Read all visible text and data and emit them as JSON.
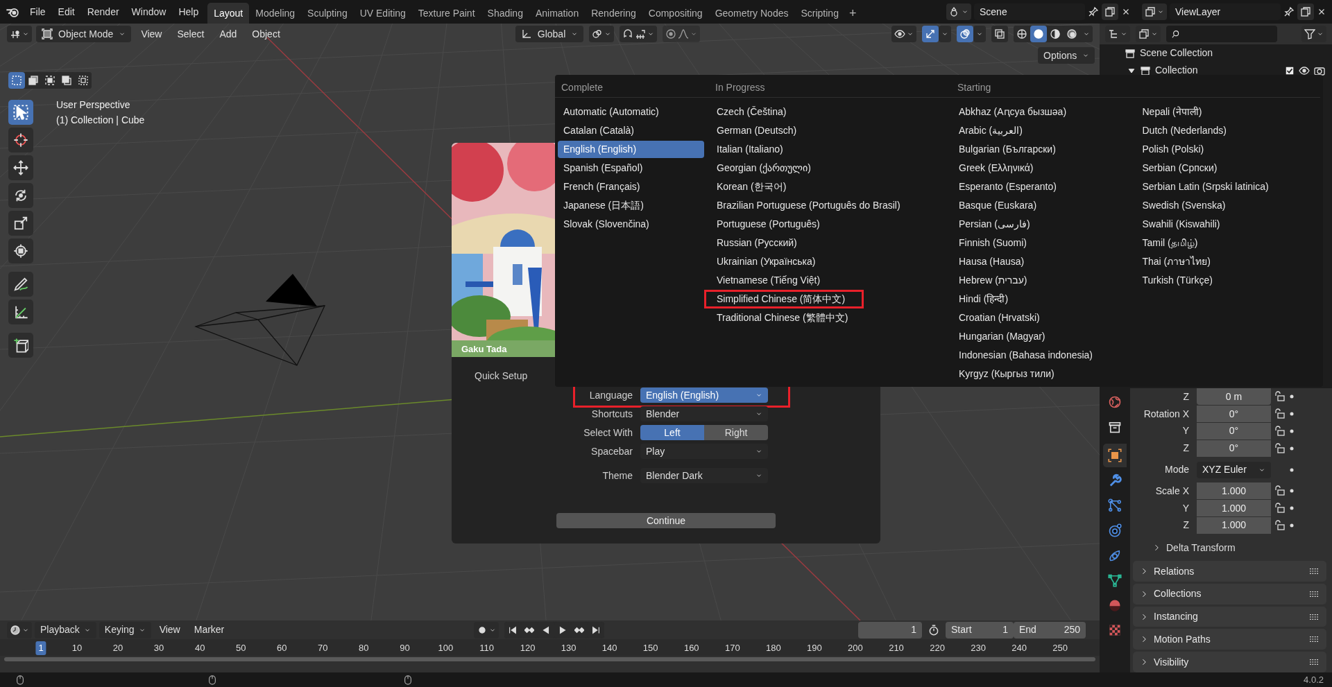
{
  "top_bar": {
    "menus": [
      "File",
      "Edit",
      "Render",
      "Window",
      "Help"
    ],
    "workspaces": [
      {
        "label": "Layout",
        "selected": true
      },
      {
        "label": "Modeling",
        "selected": false
      },
      {
        "label": "Sculpting",
        "selected": false
      },
      {
        "label": "UV Editing",
        "selected": false
      },
      {
        "label": "Texture Paint",
        "selected": false
      },
      {
        "label": "Shading",
        "selected": false
      },
      {
        "label": "Animation",
        "selected": false
      },
      {
        "label": "Rendering",
        "selected": false
      },
      {
        "label": "Compositing",
        "selected": false
      },
      {
        "label": "Geometry Nodes",
        "selected": false
      },
      {
        "label": "Scripting",
        "selected": false
      }
    ],
    "add_tab": "+",
    "scene": "Scene",
    "view_layer": "ViewLayer"
  },
  "viewport": {
    "mode": "Object Mode",
    "menus": [
      "View",
      "Select",
      "Add",
      "Object"
    ],
    "orientation": "Global",
    "options": "Options",
    "view_name": "User Perspective",
    "object_info": "(1) Collection | Cube",
    "shading": [
      {
        "kind": "wireframe",
        "selected": false
      },
      {
        "kind": "solid",
        "selected": true
      },
      {
        "kind": "material",
        "selected": false
      },
      {
        "kind": "rendered",
        "selected": false
      }
    ],
    "tools": [
      {
        "kind": "select",
        "selected": true
      },
      {
        "kind": "cursor",
        "selected": false
      },
      {
        "kind": "move",
        "selected": false
      },
      {
        "kind": "rotate",
        "selected": false
      },
      {
        "kind": "scale",
        "selected": false
      },
      {
        "kind": "transform",
        "selected": false
      },
      {
        "kind": "annotate",
        "selected": false
      },
      {
        "kind": "measure",
        "selected": false
      },
      {
        "kind": "add_cube",
        "selected": false
      }
    ]
  },
  "splash": {
    "credit": "Gaku Tada",
    "section": "Quick Setup",
    "settings": [
      {
        "kind": "dropdown",
        "label": "Language",
        "value": "English (English)",
        "active": true,
        "highlighted": true
      },
      {
        "kind": "dropdown",
        "label": "Shortcuts",
        "value": "Blender",
        "active": false,
        "highlighted": false
      },
      {
        "kind": "toggle",
        "label": "Select With",
        "options": [
          {
            "label": "Left",
            "selected": true
          },
          {
            "label": "Right",
            "selected": false
          }
        ]
      },
      {
        "kind": "dropdown",
        "label": "Spacebar",
        "value": "Play",
        "active": false,
        "highlighted": false
      },
      {
        "kind": "dropdown",
        "label": "Theme",
        "value": "Blender Dark",
        "active": false,
        "highlighted": false
      }
    ],
    "continue": "Continue"
  },
  "language_menu": {
    "groups": [
      {
        "title": "Complete",
        "columns": [
          {
            "items": [
              {
                "label": "Automatic (Automatic)",
                "selected": false,
                "highlighted": false
              },
              {
                "label": "Catalan (Català)",
                "selected": false,
                "highlighted": false
              },
              {
                "label": "English (English)",
                "selected": true,
                "highlighted": false
              },
              {
                "label": "Spanish (Español)",
                "selected": false,
                "highlighted": false
              },
              {
                "label": "French (Français)",
                "selected": false,
                "highlighted": false
              },
              {
                "label": "Japanese (日本語)",
                "selected": false,
                "highlighted": false
              },
              {
                "label": "Slovak (Slovenčina)",
                "selected": false,
                "highlighted": false
              }
            ]
          }
        ]
      },
      {
        "title": "In Progress",
        "columns": [
          {
            "items": [
              {
                "label": "Czech (Čeština)",
                "selected": false,
                "highlighted": false
              },
              {
                "label": "German (Deutsch)",
                "selected": false,
                "highlighted": false
              },
              {
                "label": "Italian (Italiano)",
                "selected": false,
                "highlighted": false
              },
              {
                "label": "Georgian (ქართული)",
                "selected": false,
                "highlighted": false
              },
              {
                "label": "Korean (한국어)",
                "selected": false,
                "highlighted": false
              },
              {
                "label": "Brazilian Portuguese (Português do Brasil)",
                "selected": false,
                "highlighted": false
              },
              {
                "label": "Portuguese (Português)",
                "selected": false,
                "highlighted": false
              },
              {
                "label": "Russian (Русский)",
                "selected": false,
                "highlighted": false
              },
              {
                "label": "Ukrainian (Українська)",
                "selected": false,
                "highlighted": false
              },
              {
                "label": "Vietnamese (Tiếng Việt)",
                "selected": false,
                "highlighted": false
              },
              {
                "label": "Simplified Chinese (简体中文)",
                "selected": false,
                "highlighted": true
              },
              {
                "label": "Traditional Chinese (繁體中文)",
                "selected": false,
                "highlighted": false
              }
            ]
          }
        ]
      },
      {
        "title": "Starting",
        "columns": [
          {
            "items": [
              {
                "label": "Abkhaz (Аԥсуа бызшәа)",
                "selected": false,
                "highlighted": false
              },
              {
                "label": "Arabic (العربية)",
                "selected": false,
                "highlighted": false
              },
              {
                "label": "Bulgarian (Български)",
                "selected": false,
                "highlighted": false
              },
              {
                "label": "Greek (Ελληνικά)",
                "selected": false,
                "highlighted": false
              },
              {
                "label": "Esperanto (Esperanto)",
                "selected": false,
                "highlighted": false
              },
              {
                "label": "Basque (Euskara)",
                "selected": false,
                "highlighted": false
              },
              {
                "label": "Persian (فارسی)",
                "selected": false,
                "highlighted": false
              },
              {
                "label": "Finnish (Suomi)",
                "selected": false,
                "highlighted": false
              },
              {
                "label": "Hausa (Hausa)",
                "selected": false,
                "highlighted": false
              },
              {
                "label": "Hebrew (עברית)",
                "selected": false,
                "highlighted": false
              },
              {
                "label": "Hindi (हिन्दी)",
                "selected": false,
                "highlighted": false
              },
              {
                "label": "Croatian (Hrvatski)",
                "selected": false,
                "highlighted": false
              },
              {
                "label": "Hungarian (Magyar)",
                "selected": false,
                "highlighted": false
              },
              {
                "label": "Indonesian (Bahasa indonesia)",
                "selected": false,
                "highlighted": false
              },
              {
                "label": "Kyrgyz (Кыргыз тили)",
                "selected": false,
                "highlighted": false
              }
            ]
          },
          {
            "items": [
              {
                "label": "Nepali (नेपाली)",
                "selected": false,
                "highlighted": false
              },
              {
                "label": "Dutch (Nederlands)",
                "selected": false,
                "highlighted": false
              },
              {
                "label": "Polish (Polski)",
                "selected": false,
                "highlighted": false
              },
              {
                "label": "Serbian (Српски)",
                "selected": false,
                "highlighted": false
              },
              {
                "label": "Serbian Latin (Srpski latinica)",
                "selected": false,
                "highlighted": false
              },
              {
                "label": "Swedish (Svenska)",
                "selected": false,
                "highlighted": false
              },
              {
                "label": "Swahili (Kiswahili)",
                "selected": false,
                "highlighted": false
              },
              {
                "label": "Tamil (தமிழ்)",
                "selected": false,
                "highlighted": false
              },
              {
                "label": "Thai (ภาษาไทย)",
                "selected": false,
                "highlighted": false
              },
              {
                "label": "Turkish (Türkçe)",
                "selected": false,
                "highlighted": false
              }
            ]
          }
        ]
      }
    ]
  },
  "outliner": {
    "root": "Scene Collection",
    "collection": {
      "label": "Collection",
      "checked": true
    }
  },
  "properties": {
    "tabs": [
      {
        "kind": "world",
        "selected": false
      },
      {
        "kind": "collection",
        "selected": false
      },
      {
        "kind": "object",
        "selected": true
      },
      {
        "kind": "modifiers",
        "selected": false
      },
      {
        "kind": "particles",
        "selected": false
      },
      {
        "kind": "physics",
        "selected": false
      },
      {
        "kind": "constraints",
        "selected": false
      },
      {
        "kind": "data",
        "selected": false
      },
      {
        "kind": "material",
        "selected": false
      },
      {
        "kind": "texture",
        "selected": false
      }
    ],
    "fields": [
      {
        "kind": "number",
        "label": "Z",
        "value": "0 m"
      },
      {
        "kind": "number",
        "label": "Rotation X",
        "value": "0°"
      },
      {
        "kind": "number",
        "label": "Y",
        "value": "0°"
      },
      {
        "kind": "number",
        "label": "Z",
        "value": "0°"
      },
      {
        "kind": "dropdown",
        "label": "Mode",
        "value": "XYZ Euler"
      },
      {
        "kind": "number",
        "label": "Scale X",
        "value": "1.000"
      },
      {
        "kind": "number",
        "label": "Y",
        "value": "1.000"
      },
      {
        "kind": "number",
        "label": "Z",
        "value": "1.000"
      }
    ],
    "subpanel": "Delta Transform",
    "panels": [
      "Relations",
      "Collections",
      "Instancing",
      "Motion Paths",
      "Visibility"
    ]
  },
  "timeline": {
    "menus": [
      "Playback",
      "Keying",
      "View",
      "Marker"
    ],
    "current_frame": "1",
    "start_label": "Start",
    "start": "1",
    "end_label": "End",
    "end": "250",
    "ruler": [
      {
        "label": "1",
        "selected": true
      },
      {
        "label": "10",
        "selected": false
      },
      {
        "label": "20",
        "selected": false
      },
      {
        "label": "30",
        "selected": false
      },
      {
        "label": "40",
        "selected": false
      },
      {
        "label": "50",
        "selected": false
      },
      {
        "label": "60",
        "selected": false
      },
      {
        "label": "70",
        "selected": false
      },
      {
        "label": "80",
        "selected": false
      },
      {
        "label": "90",
        "selected": false
      },
      {
        "label": "100",
        "selected": false
      },
      {
        "label": "110",
        "selected": false
      },
      {
        "label": "120",
        "selected": false
      },
      {
        "label": "130",
        "selected": false
      },
      {
        "label": "140",
        "selected": false
      },
      {
        "label": "150",
        "selected": false
      },
      {
        "label": "160",
        "selected": false
      },
      {
        "label": "170",
        "selected": false
      },
      {
        "label": "180",
        "selected": false
      },
      {
        "label": "190",
        "selected": false
      },
      {
        "label": "200",
        "selected": false
      },
      {
        "label": "210",
        "selected": false
      },
      {
        "label": "220",
        "selected": false
      },
      {
        "label": "230",
        "selected": false
      },
      {
        "label": "240",
        "selected": false
      },
      {
        "label": "250",
        "selected": false
      }
    ]
  },
  "status_bar": {
    "version": "4.0.2"
  }
}
